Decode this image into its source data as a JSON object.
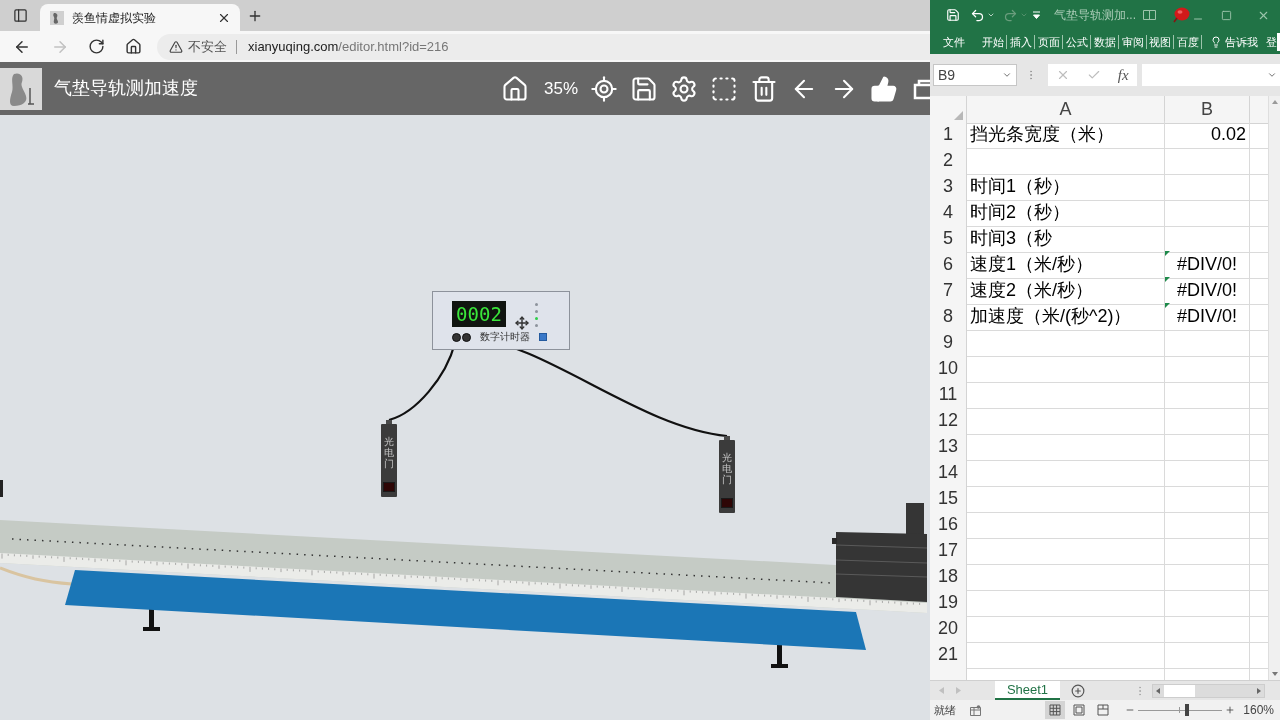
{
  "browser": {
    "tabs": [
      {
        "title": "羡鱼情虚拟实验",
        "selected": true
      }
    ],
    "nav": {
      "forward_disabled": true
    },
    "address": {
      "security": "不安全",
      "host": "xianyuqing.com",
      "path": "/editor.html?id=216"
    }
  },
  "app": {
    "title": "气垫导轨测加速度",
    "zoom": "35%"
  },
  "scene": {
    "timer": {
      "display": "0002",
      "label": "数字计时器",
      "indicators": [
        {
          "lit": false
        },
        {
          "lit": false
        },
        {
          "lit": true
        },
        {
          "lit": false
        }
      ]
    },
    "photogates": [
      {
        "label": "光电门"
      },
      {
        "label": "光电门"
      }
    ]
  },
  "excel": {
    "title": "气垫导轨测加...",
    "redo_disabled": true,
    "ribbon_tabs": [
      "文件",
      "开始",
      "插入",
      "页面",
      "公式",
      "数据",
      "审阅",
      "视图",
      "百度"
    ],
    "tell_me": "告诉我",
    "sign_in": "登",
    "name_box": "B9",
    "formula_buttons": [
      {
        "kind": "cancel",
        "disabled": true
      },
      {
        "kind": "enter",
        "disabled": true
      },
      {
        "kind": "function",
        "label": "fx",
        "disabled": false
      }
    ],
    "columns": [
      "A",
      "B"
    ],
    "rows": [
      {
        "number": "1",
        "a": "挡光条宽度（米）",
        "b": {
          "text": "0.02",
          "kind": "number",
          "flagged": false
        }
      },
      {
        "number": "2"
      },
      {
        "number": "3",
        "a": "时间1（秒）"
      },
      {
        "number": "4",
        "a": "时间2（秒）"
      },
      {
        "number": "5",
        "a": "时间3（秒"
      },
      {
        "number": "6",
        "a": "速度1（米/秒）",
        "b": {
          "text": "#DIV/0!",
          "kind": "error",
          "flagged": true
        }
      },
      {
        "number": "7",
        "a": "速度2（米/秒）",
        "b": {
          "text": "#DIV/0!",
          "kind": "error",
          "flagged": true
        }
      },
      {
        "number": "8",
        "a": "加速度（米/(秒^2)）",
        "b": {
          "text": "#DIV/0!",
          "kind": "error",
          "flagged": true
        }
      },
      {
        "number": "9"
      },
      {
        "number": "10"
      },
      {
        "number": "11"
      },
      {
        "number": "12"
      },
      {
        "number": "13"
      },
      {
        "number": "14"
      },
      {
        "number": "15"
      },
      {
        "number": "16"
      },
      {
        "number": "17"
      },
      {
        "number": "18"
      },
      {
        "number": "19"
      },
      {
        "number": "20"
      },
      {
        "number": "21"
      }
    ],
    "sheet_tabs": [
      {
        "label": "Sheet1",
        "selected": true
      }
    ],
    "status": "就绪",
    "views": [
      {
        "kind": "normal",
        "selected": true
      },
      {
        "kind": "page_layout",
        "selected": false
      },
      {
        "kind": "page_break",
        "selected": false
      }
    ],
    "zoom": {
      "level": 0.58,
      "reading": "160%"
    }
  }
}
